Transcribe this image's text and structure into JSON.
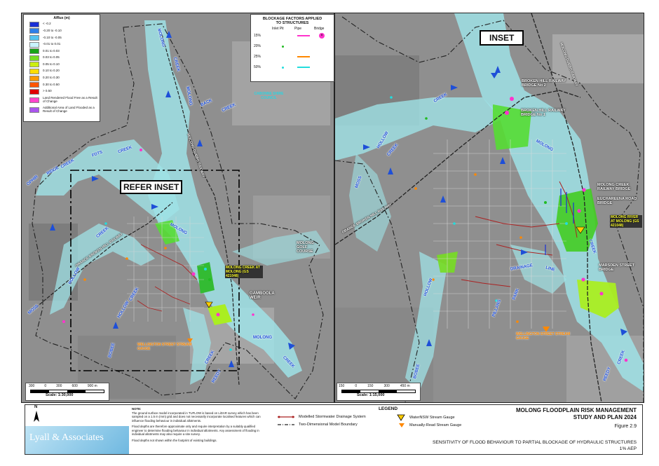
{
  "afflux_legend": {
    "title": "Afflux (m)",
    "items": [
      {
        "label": "< -0.2",
        "color": "#1a2fd6"
      },
      {
        "label": "-0.20 to -0.10",
        "color": "#2f7fe8"
      },
      {
        "label": "-0.10 to -0.05",
        "color": "#55c3f0"
      },
      {
        "label": "-0.01 to 0.01",
        "color": "#c9f4ff"
      },
      {
        "label": "0.01 to 0.03",
        "color": "#18a418"
      },
      {
        "label": "0.03 to 0.05",
        "color": "#77dd22"
      },
      {
        "label": "0.05 to 0.10",
        "color": "#ccee11"
      },
      {
        "label": "0.10 to 0.20",
        "color": "#ffdd00"
      },
      {
        "label": "0.20 to 0.30",
        "color": "#ff9900"
      },
      {
        "label": "0.30 to 0.50",
        "color": "#ff5500"
      },
      {
        "label": "> 0.50",
        "color": "#e00000"
      },
      {
        "label": "Land Rendered Flood Free as a Result of Change",
        "color": "#ff44cc"
      },
      {
        "label": "Additional Area of Land Flooded as a Result of Change",
        "color": "#aa55ee"
      }
    ]
  },
  "blockage_legend": {
    "title": "BLOCKAGE FACTORS APPLIED TO STRUCTURES",
    "headers": [
      "Inlet Pit",
      "Pipe",
      "Bridge"
    ],
    "rows": [
      {
        "label": "15%",
        "color": "#ff33cc"
      },
      {
        "label": "20%",
        "color": "#22bb22"
      },
      {
        "label": "25%",
        "color": "#ff8800"
      },
      {
        "label": "50%",
        "color": "#22dddd"
      }
    ]
  },
  "left_map": {
    "refer_inset": "REFER INSET",
    "labels": {
      "molong_n": "MOLONG",
      "creek_n": "CREEK",
      "back": "BACK",
      "creek_back": "CREEK",
      "cabonne": "CABONNE SHIRE COUNCIL",
      "fdts": "FDTS",
      "creek_w": "CREEK",
      "ridge": "RIDGE",
      "creek_r": "CREEK",
      "ophir": "OPHIR",
      "hollow": "HOLLOW",
      "moss": "MOSS",
      "creek_c": "CREEK",
      "molong_c": "MOLONG",
      "golf": "MOLONG GOLF COURSE",
      "gauge": "MOLONG CREEK AT MOLONG (GS 421048)",
      "gamboola": "GAMBOOLA WEIR",
      "wellington": "WELLINGTON STREET STREAM GAUGE",
      "molong_s": "MOLONG",
      "creek_se": "CREEK",
      "creek_s": "CREEK",
      "reedy": "REEDY",
      "bobee": "BOBEE",
      "hollow_s": "HOLLOW",
      "creek_s2": "CREEK",
      "railway": "ORANGE BROKEN HILL RAILWAY",
      "railway2": "MOLONG-DUBBO RAILWAY"
    },
    "scale_ticks": [
      "300",
      "0",
      "300",
      "600",
      "900 m"
    ],
    "scale_text": "Scale: 1:30,000"
  },
  "inset_map": {
    "title": "INSET",
    "labels": {
      "bh2": "BROKEN HILL RAILWAY BRIDGE No 2",
      "bh1": "BROKEN HILL RAILWAY BRIDGE No 1",
      "mcrb": "MOLONG CREEK RAILWAY BRIDGE",
      "euch": "EUCHAREENA ROAD BRIDGE",
      "gauge": "MOLONG RIVER AT MOLONG (GS 421048)",
      "marsden": "MARSDEN STREET BRIDGE",
      "wellington": "WELLINGTON STREET STREAM GAUGE",
      "molong": "MOLONG",
      "creek1": "CREEK",
      "creek2": "CREEK",
      "creek3": "CREEK",
      "hollow": "HOLLOW",
      "moss": "MOSS",
      "drainage": "DRAINAGE",
      "line": "LINE",
      "park": "PARK",
      "pillans": "PILLANS",
      "hollow2": "HOLLOW",
      "bobee": "BOBEE",
      "reedy": "REEDY",
      "creek4": "CREEK",
      "railway": "ORANGE BROKEN HILL RAILWAY",
      "railway2": "MOLONG-DUBBO RAILWAY"
    },
    "scale_ticks": [
      "150",
      "0",
      "150",
      "300",
      "450 m"
    ],
    "scale_text": "Scale: 1:15,000"
  },
  "footer": {
    "north": "N",
    "logo": "Lyall & Associates",
    "note_title": "NOTE:",
    "notes": [
      "The ground surface model incorporated in TUFLOW is based on LiDAR survey which has been sampled on a 1.5 m (mm) grid and does not necessarily incorporate localised features which can influence flooding behaviour in individual allotments.",
      "Flood depths are therefore approximate only and require interpretation by a suitably qualified engineer to determine flooding behaviour in individual allotments. Any assessment of flooding in individual allotments may also require a site survey.",
      "Flood depths not shown within the footprint of existing buildings."
    ],
    "legend_title": "LEGEND",
    "legend_items": [
      "Modelled Stormwater Drainage System",
      "Two-Dimensional Model Boundary",
      "WaterNSW Stream Gauge",
      "Manually-Read Stream Gauge"
    ],
    "study_title_1": "MOLONG FLOODPLAIN RISK MANAGEMENT",
    "study_title_2": "STUDY AND PLAN 2024",
    "figure": "Figure 2.9",
    "fig_title": "SENSITIVITY OF FLOOD BEHAVIOUR TO PARTIAL BLOCKAGE OF HYDRAULIC STRUCTURES",
    "aep": "1% AEP"
  }
}
